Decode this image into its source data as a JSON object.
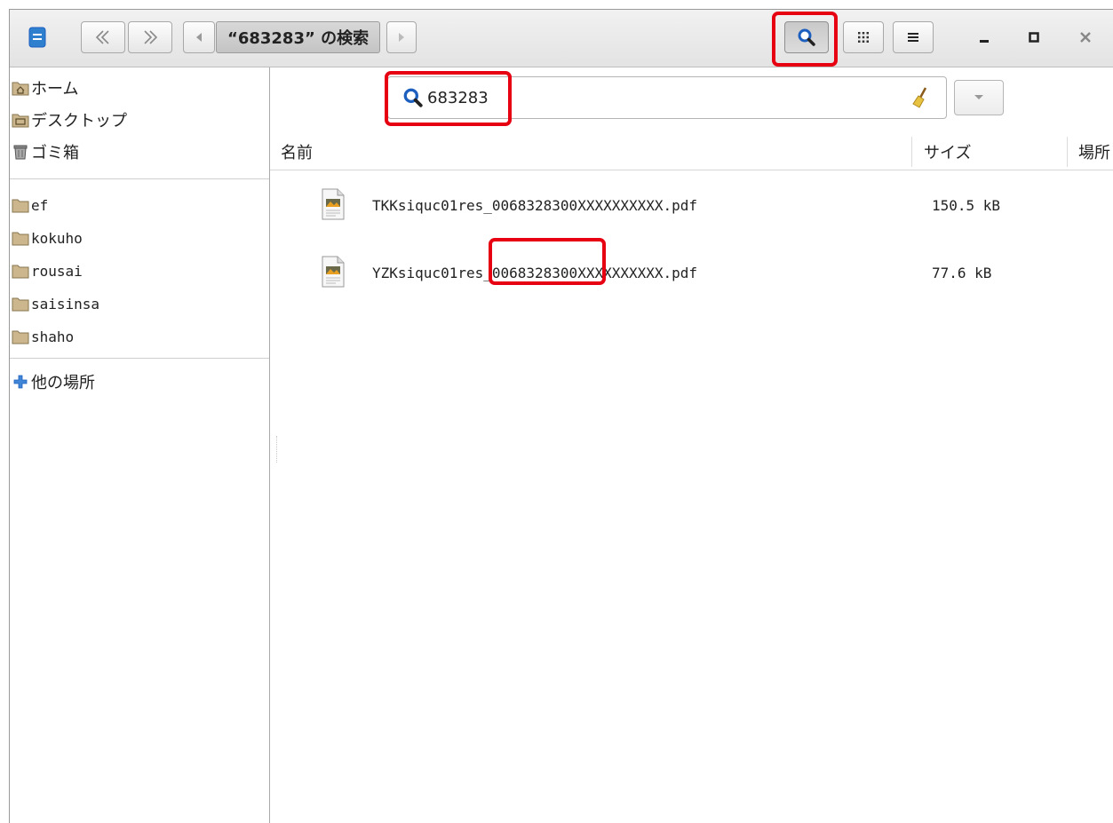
{
  "header": {
    "title": "“683283” の検索",
    "colors": {
      "highlight": "#e60012",
      "accent_blue": "#1d5fbf"
    }
  },
  "search": {
    "value": "683283"
  },
  "sidebar": {
    "places": [
      {
        "label": "ホーム",
        "icon": "home-folder-icon"
      },
      {
        "label": "デスクトップ",
        "icon": "desktop-folder-icon"
      },
      {
        "label": "ゴミ箱",
        "icon": "trash-icon"
      }
    ],
    "bookmarks": [
      {
        "label": "ef",
        "icon": "folder-icon"
      },
      {
        "label": "kokuho",
        "icon": "folder-icon"
      },
      {
        "label": "rousai",
        "icon": "folder-icon"
      },
      {
        "label": "saisinsa",
        "icon": "folder-icon"
      },
      {
        "label": "shaho",
        "icon": "folder-icon"
      }
    ],
    "other": {
      "label": "他の場所",
      "icon": "plus-icon"
    }
  },
  "columns": {
    "name": "名前",
    "size": "サイズ",
    "location": "場所"
  },
  "files": [
    {
      "name": "TKKsiquc01res_0068328300XXXXXXXXXX.pdf",
      "size": "150.5 kB",
      "icon": "pdf-document-icon"
    },
    {
      "name": "YZKsiquc01res_0068328300XXXXXXXXXX.pdf",
      "size": "77.6 kB",
      "icon": "pdf-document-icon"
    }
  ]
}
